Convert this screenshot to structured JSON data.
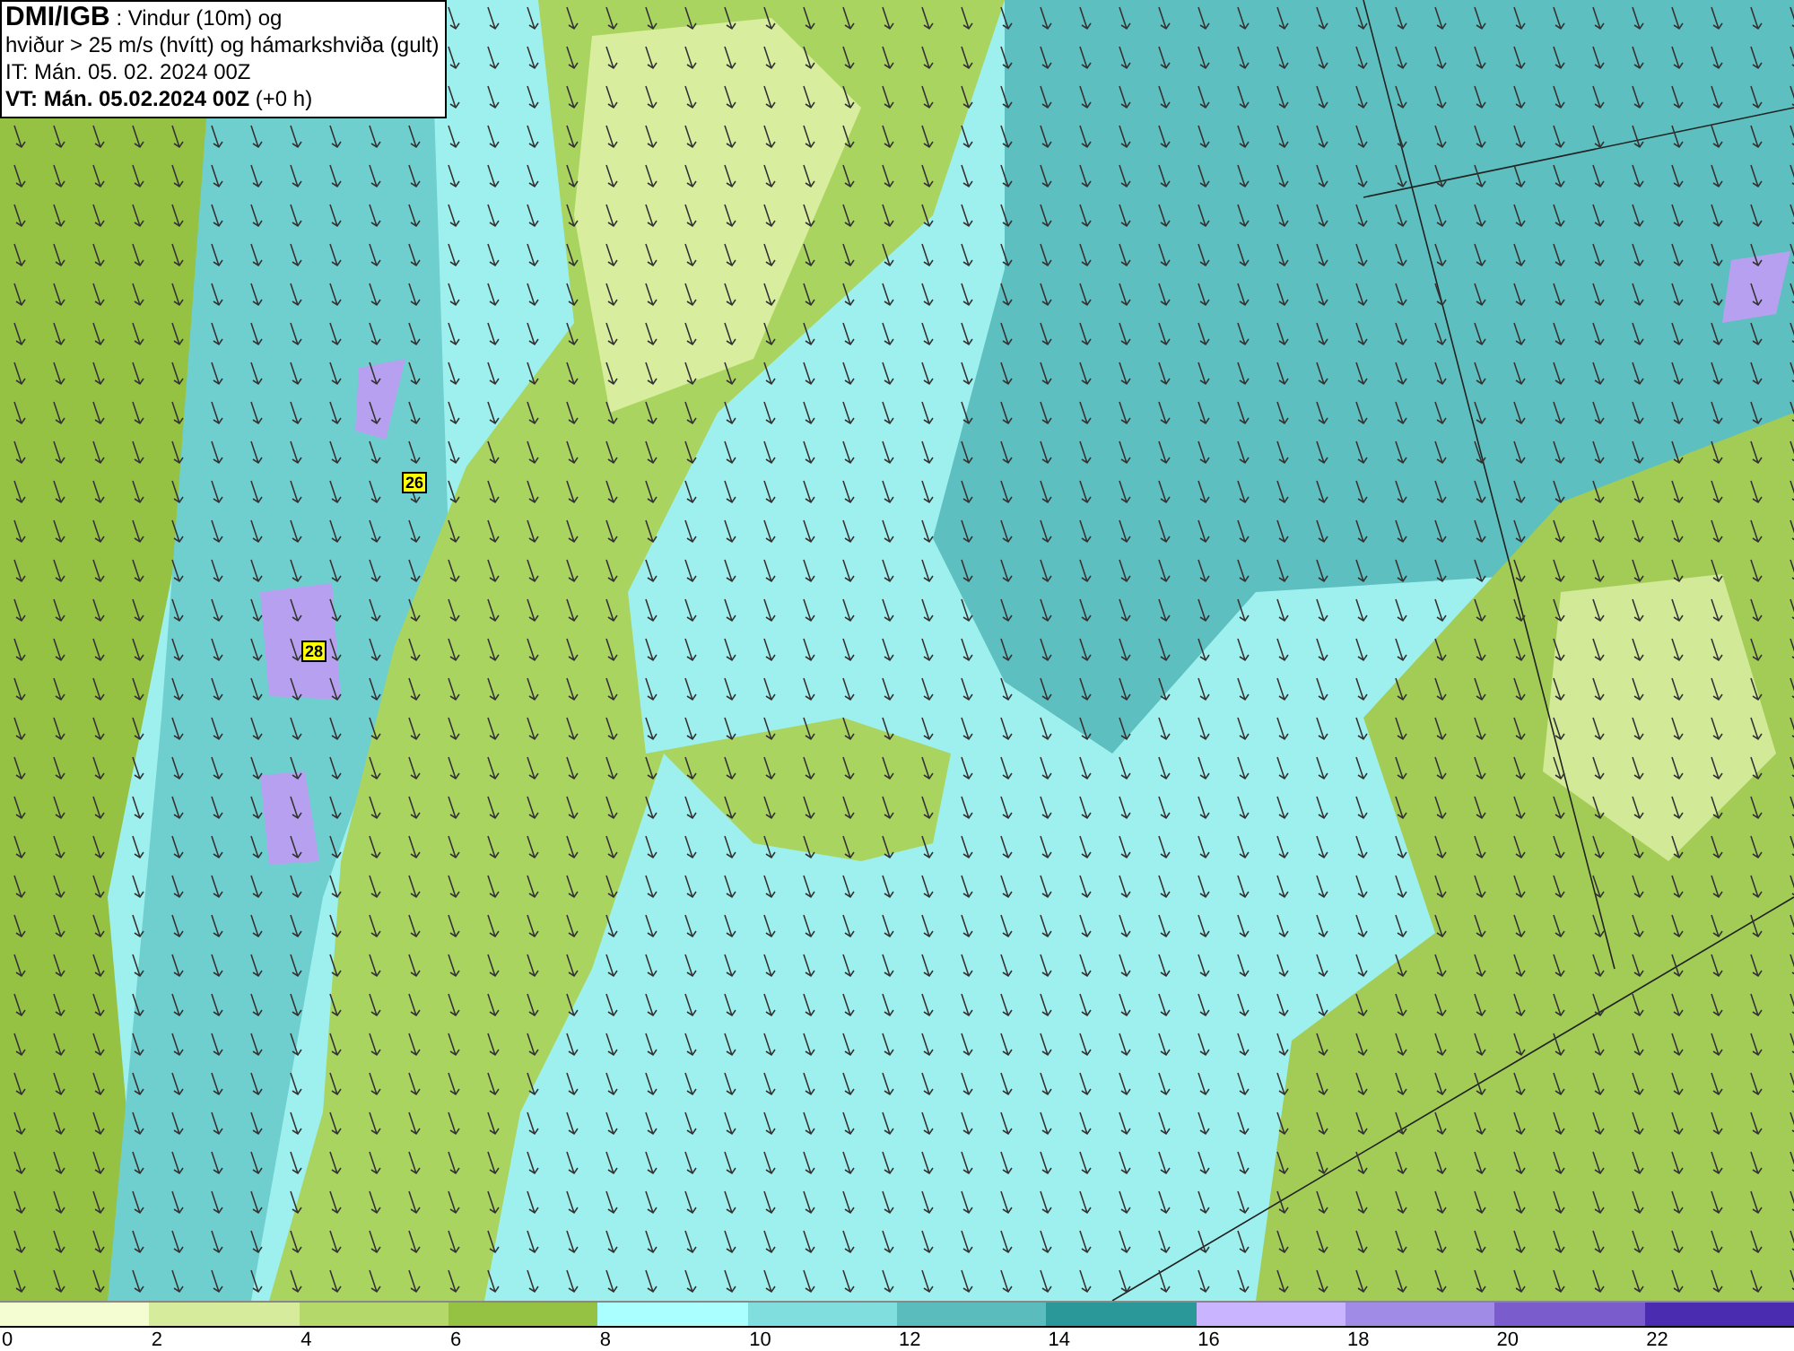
{
  "header": {
    "source": "DMI/IGB",
    "title": ": Vindur (10m) og",
    "subtitle": "hviður > 25 m/s (hvítt) og hámarkshviða (gult)",
    "issue_time": "IT: Mán. 05. 02. 2024 00Z",
    "valid_time": "VT: Mán. 05.02.2024 00Z",
    "offset": "(+0 h)"
  },
  "map": {
    "gust_labels": [
      {
        "value": "26"
      },
      {
        "value": "28"
      }
    ]
  },
  "legend": [
    {
      "label": "0",
      "color": "#f4fcd2"
    },
    {
      "label": "2",
      "color": "#d6ec9c"
    },
    {
      "label": "4",
      "color": "#b4d86a"
    },
    {
      "label": "6",
      "color": "#96c244"
    },
    {
      "label": "8",
      "color": "#aaffff"
    },
    {
      "label": "10",
      "color": "#80dede"
    },
    {
      "label": "12",
      "color": "#5abcbc"
    },
    {
      "label": "14",
      "color": "#2a9898"
    },
    {
      "label": "16",
      "color": "#c8b4ff"
    },
    {
      "label": "18",
      "color": "#a08ce6"
    },
    {
      "label": "20",
      "color": "#7a5ccd"
    },
    {
      "label": "22",
      "color": "#4a2cb0"
    }
  ]
}
